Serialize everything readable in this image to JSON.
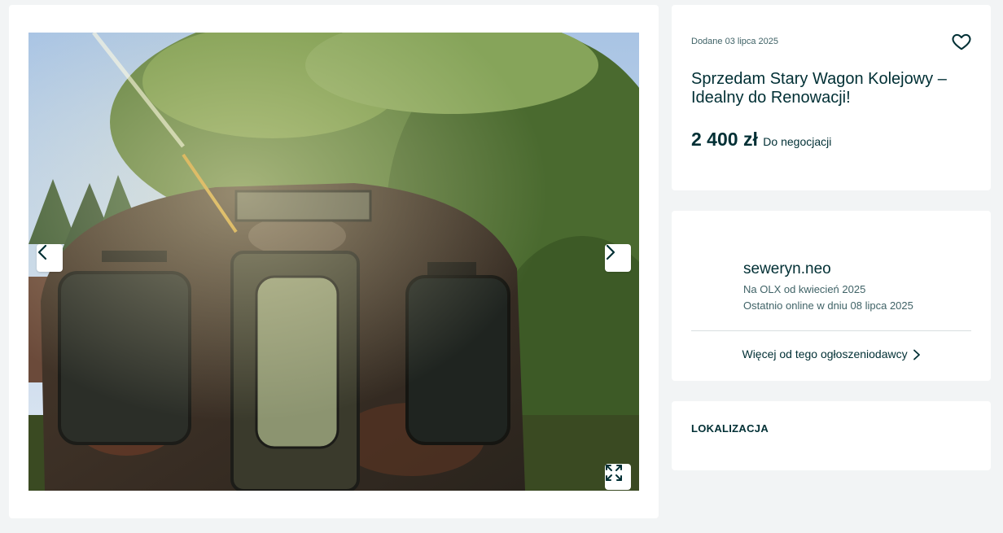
{
  "gallery": {
    "image_alt": "Stary wagon kolejowy wśród drzew"
  },
  "ad": {
    "added_date": "Dodane 03 lipca 2025",
    "title": "Sprzedam Stary Wagon Kolejowy – Idealny do Renowacji!",
    "price": "2 400 zł",
    "negotiable": "Do negocjacji"
  },
  "seller": {
    "name": "seweryn.neo",
    "since": "Na OLX od kwiecień 2025",
    "last_online": "Ostatnio online w dniu 08 lipca 2025",
    "more_link": "Więcej od tego ogłoszeniodawcy"
  },
  "location": {
    "title": "LOKALIZACJA"
  },
  "icons": {
    "prev": "chevron-left-icon",
    "next": "chevron-right-icon",
    "expand": "expand-icon",
    "favorite": "heart-icon",
    "more": "chevron-right-icon"
  },
  "colors": {
    "background": "#f2f4f5",
    "card": "#ffffff",
    "text_primary": "#002f34",
    "text_secondary": "#406367"
  }
}
